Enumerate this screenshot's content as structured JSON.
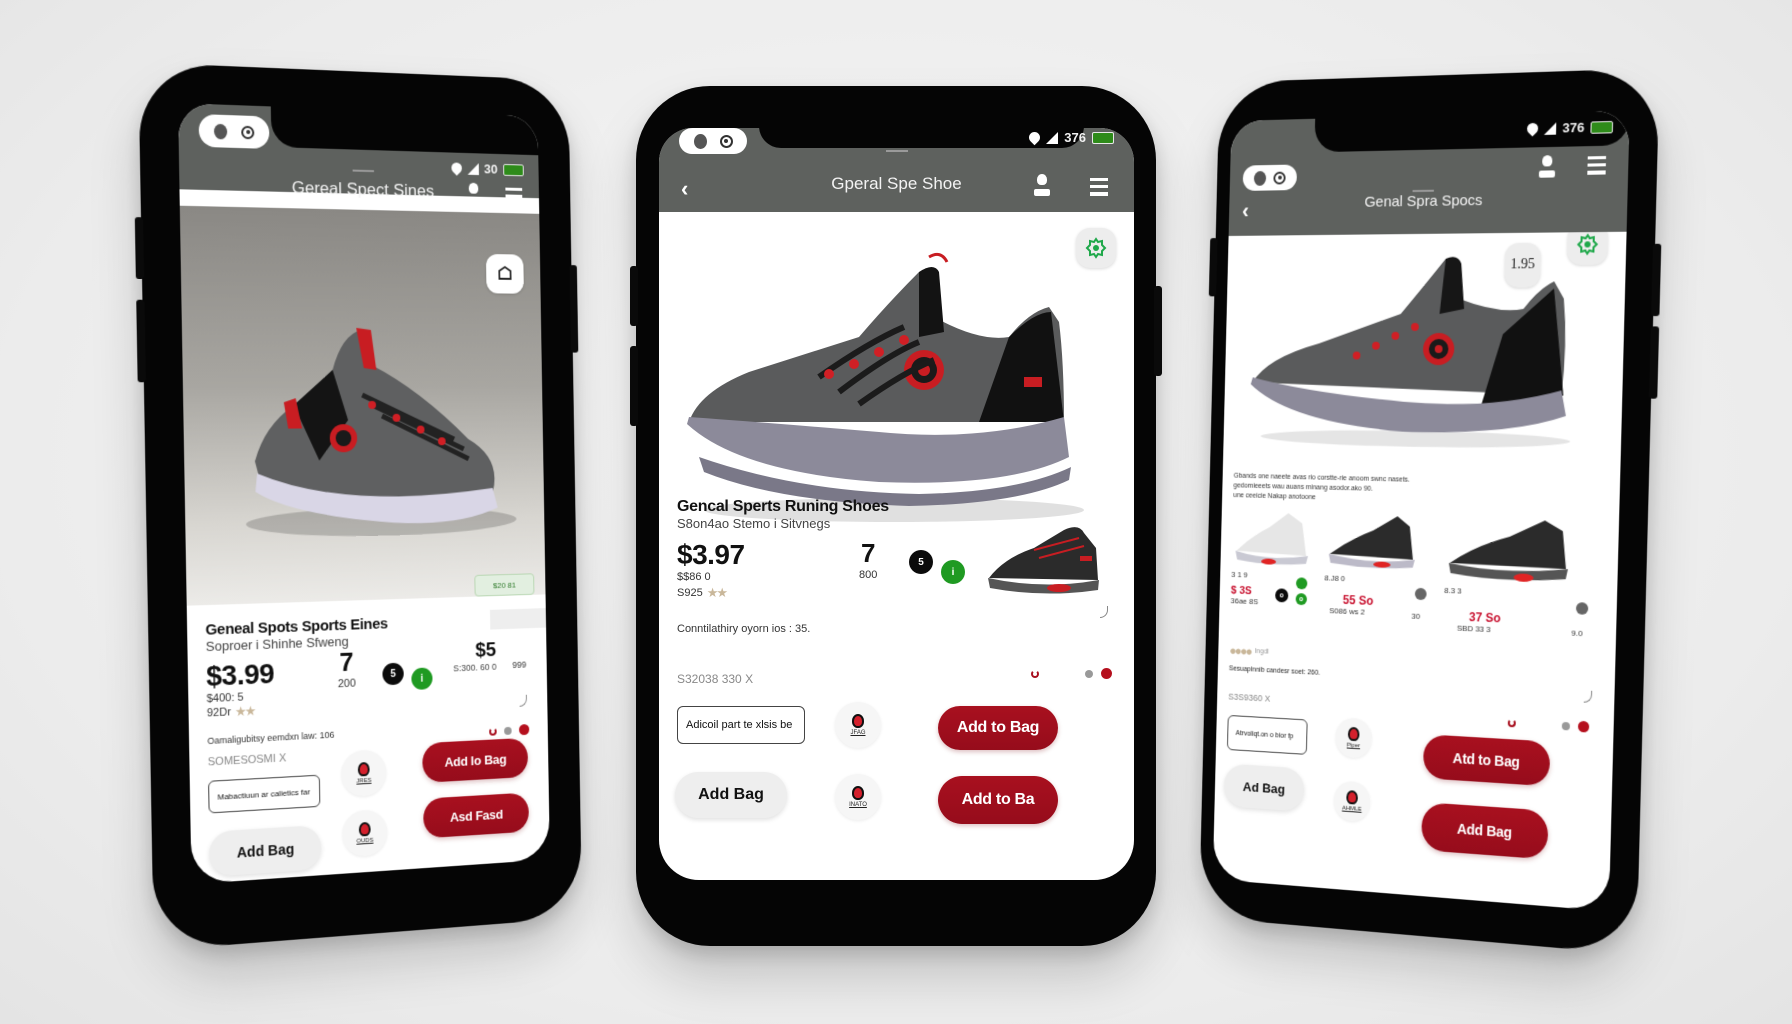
{
  "colors": {
    "appbar": "#5e615e",
    "accent_red": "#a8101f",
    "battery_green": "#2e8b1a",
    "badge_green": "#1f9a22"
  },
  "phones": [
    {
      "id": "left",
      "status": {
        "time": "30",
        "battery": "full"
      },
      "header": {
        "back_icon": "back-chevron-icon",
        "title": "Gereal Spect Sines",
        "user_icon": "user-icon",
        "menu_icon": "menu-icon"
      },
      "hero_badge_icon": "house-outline-icon",
      "hero_chip_text": "$20 81",
      "product": {
        "name": "Geneal Spots Sports Eines",
        "subtitle": "Soproer i Shinhe Sfweng",
        "price": "$3.99",
        "price_sub": "$400: 5",
        "rating_text": "92Dr",
        "qty": "7",
        "qty_sub": "200",
        "dot1": "5",
        "dot2": "i",
        "alt_price": "$5",
        "alt_price_sub": "S:300. 60 0",
        "alt_price_right": "999"
      },
      "description": "Oamaligubitsy eemdxn law: 106",
      "promo_code": "SOMESOSMI X",
      "input_value": "Mabactiuun ar calietics far",
      "logo_labels": [
        "JRES",
        "OUDS"
      ],
      "buttons": {
        "secondary": "Add Bag",
        "primary_top": "Add lo Bag",
        "primary_bottom": "Asd Fasd"
      }
    },
    {
      "id": "center",
      "status": {
        "time": "376",
        "battery": "full"
      },
      "header": {
        "back_icon": "back-chevron-icon",
        "title": "Gperal Spe Shoe",
        "user_icon": "user-icon",
        "menu_icon": "menu-icon"
      },
      "hero_badge_icon": "green-gear-icon",
      "product": {
        "name": "Gencal Sperts Runing Shoes",
        "subtitle": "S8on4ao Stemo i Sitvnegs",
        "price": "$3.97",
        "price_sub": "$$86 0",
        "rating_text": "S925",
        "qty": "7",
        "qty_sub": "800",
        "dot1": "5",
        "dot2": "i"
      },
      "description": "Conntilathiry oyorn ios : 35.",
      "promo_code": "S32038 330  X",
      "input_value": "Adicoil part te xlsis be",
      "logo_labels": [
        "JFAG",
        "INATO"
      ],
      "buttons": {
        "secondary": "Add Bag",
        "primary_top": "Add to Bag",
        "primary_bottom": "Add to Ba"
      }
    },
    {
      "id": "right",
      "status": {
        "time": "376",
        "battery": "full"
      },
      "header": {
        "back_icon": "back-chevron-icon",
        "title": "Genal Spra Spocs",
        "user_icon": "user-icon",
        "menu_icon": "menu-icon"
      },
      "hero_badge_icon": "green-gear-icon",
      "hero_size_badge": "1.95",
      "intro_text": [
        "Gbands one naeete avas rio corstte-rie anoom swnc nasets.",
        "gedomieeets wau auans minang asodor.ako 90.",
        "une ceeicie Nakap anotoone"
      ],
      "variants": [
        {
          "code": "3 1 9",
          "price": "$ 3S",
          "sub": "36ae 8S",
          "dot1": "o",
          "dot2": "o"
        },
        {
          "code": "8.J8 0",
          "price": "55 So",
          "sub": "S086 ws 2",
          "side": "30"
        },
        {
          "code": "8.3 3",
          "price": "37 So",
          "sub": "SBD 33 3",
          "side": "9.0"
        }
      ],
      "rating_text": "Ingdl",
      "description": "Sesuaplnnib candesr soet: 260.",
      "promo_code": "S3S9360  X",
      "input_value": "Atrvoliqt.on o bior fp",
      "logo_labels": [
        "Piper",
        "AHMLE"
      ],
      "buttons": {
        "secondary": "Ad Bag",
        "primary_top": "Atd to Bag",
        "primary_bottom": "Add Bag"
      }
    }
  ]
}
